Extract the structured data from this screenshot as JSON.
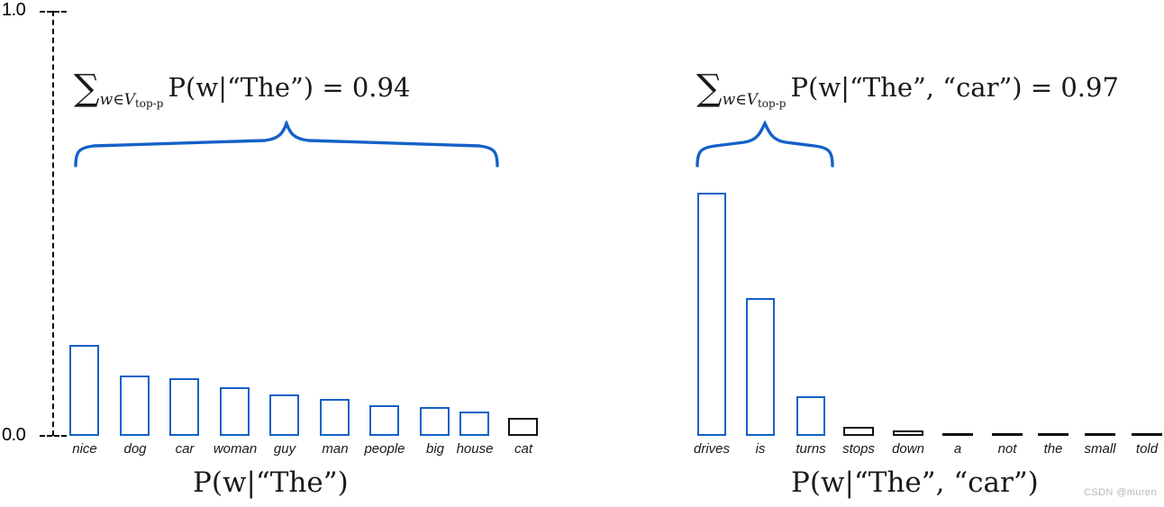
{
  "axis": {
    "top_label": "1.0",
    "bottom_label": "0.0"
  },
  "watermark": "CSDN @muren",
  "panels": [
    {
      "id": "left",
      "formula": {
        "sum_symbol": "∑",
        "subscript_prefix": "w∈V",
        "subscript_suffix": "top-p",
        "expression": "P(w|“The”) = 0.94",
        "value": "0.94"
      },
      "caption": "P(w|“The”)",
      "brace_color": "#1461c8"
    },
    {
      "id": "right",
      "formula": {
        "sum_symbol": "∑",
        "subscript_prefix": "w∈V",
        "subscript_suffix": "top-p",
        "expression": "P(w|“The”, “car”) = 0.97",
        "value": "0.97"
      },
      "caption": "P(w|“The”, “car”)",
      "brace_color": "#1461c8"
    }
  ],
  "chart_data": [
    {
      "type": "bar",
      "id": "left-distribution",
      "title": "P(w|“The”)",
      "annotation": "∑_{w∈V_top-p} P(w|“The”) = 0.94",
      "xlabel": "",
      "ylabel": "",
      "ylim": [
        0.0,
        1.0
      ],
      "ytick_labels": [
        "0.0",
        "1.0"
      ],
      "grid": false,
      "legend": null,
      "categories": [
        "nice",
        "dog",
        "car",
        "woman",
        "guy",
        "man",
        "people",
        "big",
        "house",
        "cat"
      ],
      "values": [
        0.21,
        0.14,
        0.135,
        0.115,
        0.098,
        0.088,
        0.073,
        0.07,
        0.056,
        0.042
      ],
      "selected_mask": [
        true,
        true,
        true,
        true,
        true,
        true,
        true,
        true,
        true,
        false
      ],
      "selected_sum": 0.94,
      "colors": {
        "selected": "#1461c8",
        "unselected": "#111111"
      }
    },
    {
      "type": "bar",
      "id": "right-distribution",
      "title": "P(w|“The”, “car”)",
      "annotation": "∑_{w∈V_top-p} P(w|“The”, “car”) = 0.97",
      "xlabel": "",
      "ylabel": "",
      "ylim": [
        0.0,
        1.0
      ],
      "ytick_labels": [
        "0.0",
        "1.0"
      ],
      "grid": false,
      "legend": null,
      "categories": [
        "drives",
        "is",
        "turns",
        "stops",
        "down",
        "a",
        "not",
        "the",
        "small",
        "told"
      ],
      "values": [
        0.57,
        0.32,
        0.09,
        0.017,
        0.009,
        0.004,
        0.004,
        0.004,
        0.004,
        0.004
      ],
      "selected_mask": [
        true,
        true,
        true,
        false,
        false,
        false,
        false,
        false,
        false,
        false
      ],
      "selected_sum": 0.97,
      "colors": {
        "selected": "#1461c8",
        "unselected": "#111111"
      }
    }
  ]
}
